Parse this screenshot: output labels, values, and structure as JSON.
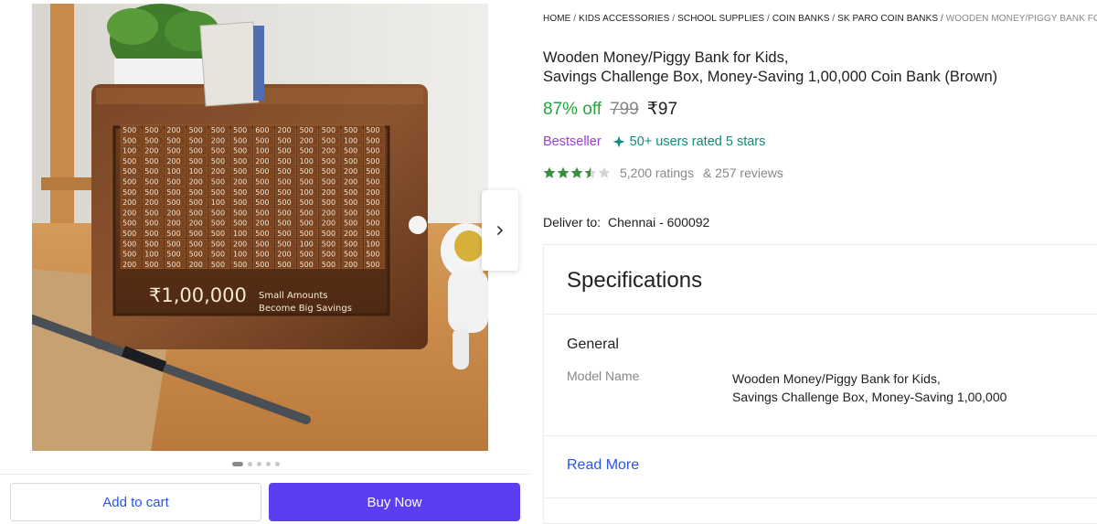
{
  "breadcrumb": [
    "HOME",
    "KIDS ACCESSORIES",
    "SCHOOL SUPPLIES",
    "COIN BANKS",
    "SK PARO COIN BANKS",
    "WOODEN MONEY/PIGGY BANK FO"
  ],
  "product": {
    "title_line1": "Wooden Money/Piggy Bank for Kids,",
    "title_line2": "Savings Challenge Box, Money-Saving 1,00,000 Coin Bank (Brown)",
    "discount": "87% off",
    "mrp": "799",
    "price": "₹97",
    "bestseller": "Bestseller",
    "rated_badge": "50+ users rated 5 stars",
    "rating_value": 3.5,
    "ratings_text": "5,200 ratings",
    "reviews_text": "& 257 reviews"
  },
  "image": {
    "amount": "₹1,00,000",
    "tagline_line1": "Small Amounts",
    "tagline_line2": "Become Big Savings",
    "grid_rows": [
      [
        "500",
        "500",
        "200",
        "500",
        "500",
        "500",
        "600",
        "200",
        "500",
        "500",
        "500",
        "500"
      ],
      [
        "500",
        "500",
        "500",
        "500",
        "200",
        "500",
        "500",
        "500",
        "200",
        "500",
        "100",
        "500"
      ],
      [
        "100",
        "200",
        "500",
        "500",
        "500",
        "500",
        "100",
        "500",
        "500",
        "200",
        "500",
        "500"
      ],
      [
        "500",
        "500",
        "200",
        "500",
        "500",
        "500",
        "200",
        "500",
        "100",
        "500",
        "500",
        "500"
      ],
      [
        "500",
        "500",
        "100",
        "100",
        "200",
        "500",
        "500",
        "500",
        "500",
        "500",
        "200",
        "500"
      ],
      [
        "500",
        "500",
        "500",
        "200",
        "500",
        "200",
        "500",
        "500",
        "500",
        "500",
        "200",
        "500"
      ],
      [
        "500",
        "500",
        "500",
        "500",
        "500",
        "500",
        "500",
        "500",
        "100",
        "200",
        "500",
        "200"
      ],
      [
        "200",
        "200",
        "500",
        "500",
        "100",
        "500",
        "500",
        "500",
        "500",
        "500",
        "500",
        "500"
      ],
      [
        "200",
        "500",
        "200",
        "500",
        "500",
        "500",
        "500",
        "500",
        "500",
        "200",
        "500",
        "500"
      ],
      [
        "500",
        "500",
        "200",
        "200",
        "500",
        "500",
        "200",
        "500",
        "500",
        "200",
        "500",
        "500"
      ],
      [
        "500",
        "500",
        "500",
        "500",
        "500",
        "100",
        "500",
        "500",
        "500",
        "500",
        "200",
        "500"
      ],
      [
        "500",
        "500",
        "500",
        "500",
        "500",
        "200",
        "500",
        "500",
        "100",
        "500",
        "500",
        "100"
      ],
      [
        "500",
        "100",
        "500",
        "500",
        "500",
        "100",
        "500",
        "200",
        "500",
        "500",
        "500",
        "500"
      ],
      [
        "200",
        "500",
        "500",
        "200",
        "500",
        "500",
        "500",
        "500",
        "500",
        "500",
        "200",
        "500"
      ]
    ],
    "carousel_count": 5,
    "carousel_active": 0
  },
  "actions": {
    "add_to_cart": "Add to cart",
    "buy_now": "Buy Now"
  },
  "delivery": {
    "label": "Deliver to:",
    "location": "Chennai - 600092"
  },
  "specifications": {
    "heading": "Specifications",
    "group": "General",
    "key": "Model Name",
    "value_line1": "Wooden Money/Piggy Bank for Kids,",
    "value_line2": "Savings Challenge Box, Money-Saving 1,00,000",
    "read_more": "Read More"
  },
  "colors": {
    "discount": "#26a541",
    "bestseller": "#9b3fd8",
    "rated": "#0b8c79",
    "star": "#388e3c",
    "buy_now": "#5a3ff0",
    "link": "#2a55e5"
  }
}
